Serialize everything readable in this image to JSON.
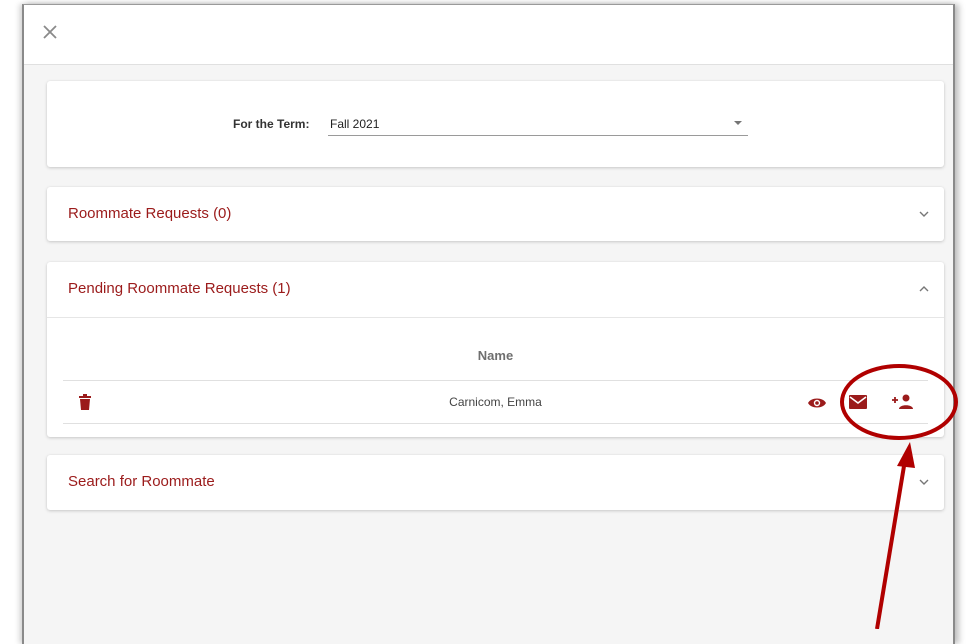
{
  "term": {
    "label": "For the Term:",
    "value": "Fall 2021"
  },
  "sections": {
    "roommate_requests": {
      "title": "Roommate Requests (0)"
    },
    "pending_requests": {
      "title": "Pending Roommate Requests (1)",
      "column_header": "Name",
      "rows": [
        {
          "name": "Carnicom, Emma"
        }
      ]
    },
    "search": {
      "title": "Search for Roommate"
    }
  },
  "colors": {
    "accent": "#9b1b1b",
    "annotation": "#b00000"
  },
  "icons": {
    "close": "close-icon",
    "trash": "trash-icon",
    "eye": "eye-icon",
    "mail": "mail-icon",
    "add_person": "add-person-icon",
    "chevron_down": "chevron-down-icon",
    "chevron_up": "chevron-up-icon"
  }
}
